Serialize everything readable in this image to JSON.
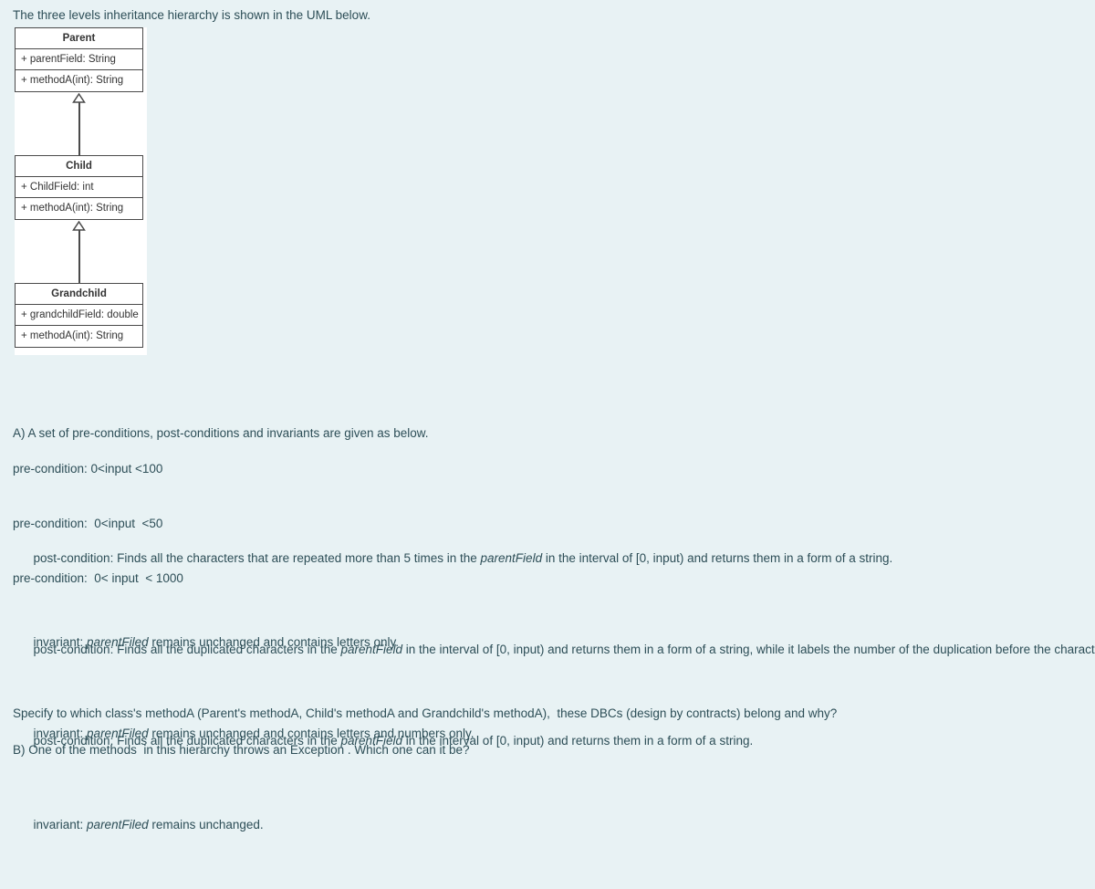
{
  "intro": {
    "text": "The three levels inheritance hierarchy is shown in the UML below."
  },
  "uml": {
    "diagram_type": "class-diagram",
    "relationship": "generalization",
    "classes": [
      {
        "name": "Parent",
        "field": "+ parentField: String",
        "method": "+ methodA(int): String"
      },
      {
        "name": "Child",
        "field": "+ ChildField: int",
        "method": "+ methodA(int): String"
      },
      {
        "name": "Grandchild",
        "field": "+ grandchildField: double",
        "method": "+ methodA(int): String"
      }
    ]
  },
  "question_a": {
    "heading": "A) A set of pre-conditions, post-conditions and invariants are given as below.",
    "preconditions": [
      "pre-condition: 0<input <100",
      "pre-condition:  0<input  <50",
      "pre-condition:  0< input  < 1000"
    ],
    "postconditions": [
      {
        "prefix": "post-condition: Finds all the characters that are repeated more than 5 times in the ",
        "emphasis": "parentField",
        "suffix": " in the interval of [0, input) and returns them in a form of a string."
      },
      {
        "prefix": "post-condition: Finds all the duplicated characters in the ",
        "emphasis": "parentField",
        "suffix": " in the interval of [0, input) and returns them in a form of a string, while it labels the number of the duplication before the character"
      },
      {
        "prefix": "post-condition: Finds all the duplicated characters in the ",
        "emphasis": "parentField",
        "suffix": " in the interval of [0, input) and returns them in a form of a string."
      }
    ],
    "invariants": [
      {
        "prefix": "invariant: ",
        "emphasis": "parentFiled",
        "suffix": " remains unchanged and contains letters only."
      },
      {
        "prefix": "invariant: ",
        "emphasis": "parentFiled",
        "suffix": " remains unchanged and contains letters and numbers only."
      },
      {
        "prefix": "invariant: ",
        "emphasis": "parentFiled",
        "suffix": " remains unchanged."
      }
    ],
    "specify": "Specify to which class's methodA (Parent's methodA, Child's methodA and Grandchild's methodA),  these DBCs (design by contracts) belong and why?"
  },
  "question_b": {
    "text": "B) One of the methods  in this hierarchy throws an Exception . Which one can it be?"
  },
  "colors": {
    "page_background": "#e8f2f4",
    "text": "#2d4e57",
    "diagram_background": "#ffffff",
    "diagram_border": "#4a4a4a",
    "diagram_text": "#333333"
  }
}
